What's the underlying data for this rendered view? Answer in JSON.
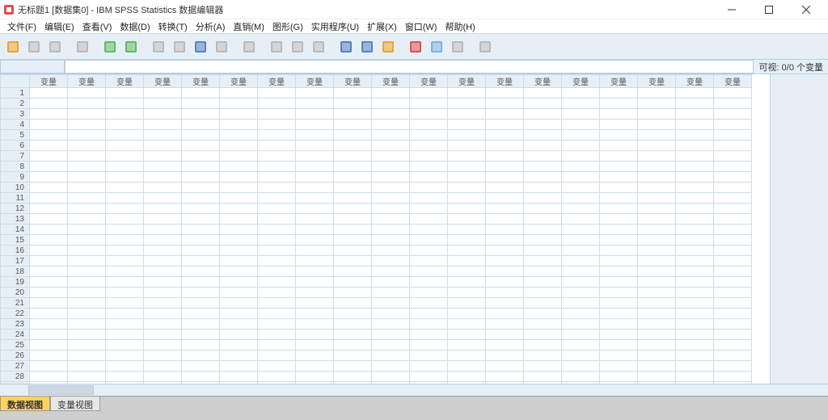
{
  "window": {
    "title": "无标题1 [数据集0] - IBM SPSS Statistics 数据编辑器",
    "visibility_status": "可视: 0/0 个变量"
  },
  "menu": [
    {
      "label": "文件(F)",
      "n": "file"
    },
    {
      "label": "编辑(E)",
      "n": "edit"
    },
    {
      "label": "查看(V)",
      "n": "view"
    },
    {
      "label": "数据(D)",
      "n": "data"
    },
    {
      "label": "转换(T)",
      "n": "transform"
    },
    {
      "label": "分析(A)",
      "n": "analyze"
    },
    {
      "label": "直销(M)",
      "n": "direct"
    },
    {
      "label": "图形(G)",
      "n": "graphs"
    },
    {
      "label": "实用程序(U)",
      "n": "utilities"
    },
    {
      "label": "扩展(X)",
      "n": "extensions"
    },
    {
      "label": "窗口(W)",
      "n": "window"
    },
    {
      "label": "帮助(H)",
      "n": "help"
    }
  ],
  "toolbar": [
    {
      "n": "open-icon",
      "c": "#e6951a",
      "en": true
    },
    {
      "n": "save-icon",
      "c": "#888",
      "en": false
    },
    {
      "n": "print-icon",
      "c": "#888",
      "en": false
    },
    {
      "sep": true
    },
    {
      "n": "recall-icon",
      "c": "#888",
      "en": false
    },
    {
      "sep": true
    },
    {
      "n": "undo-icon",
      "c": "#4caf50",
      "en": true
    },
    {
      "n": "redo-icon",
      "c": "#4caf50",
      "en": true
    },
    {
      "sep": true
    },
    {
      "n": "goto-case-icon",
      "c": "#888",
      "en": false
    },
    {
      "n": "goto-var-icon",
      "c": "#888",
      "en": false
    },
    {
      "n": "vars-icon",
      "c": "#3f6fb5",
      "en": true
    },
    {
      "n": "run-desc-icon",
      "c": "#888",
      "en": false
    },
    {
      "sep": true
    },
    {
      "n": "find-icon",
      "c": "#888",
      "en": false
    },
    {
      "sep": true
    },
    {
      "n": "split-icon",
      "c": "#888",
      "en": false
    },
    {
      "n": "weight-icon",
      "c": "#888",
      "en": false
    },
    {
      "n": "select-cases-icon",
      "c": "#888",
      "en": false
    },
    {
      "sep": true
    },
    {
      "n": "value-labels-icon",
      "c": "#3f6fb5",
      "en": true
    },
    {
      "n": "use-sets-icon",
      "c": "#3f6fb5",
      "en": true
    },
    {
      "n": "show-all-icon",
      "c": "#e6951a",
      "en": true
    },
    {
      "sep": true
    },
    {
      "n": "spellcheck-a-icon",
      "c": "#d13a3a",
      "en": true
    },
    {
      "n": "customize-icon",
      "c": "#6aa7d8",
      "en": true
    },
    {
      "n": "script-icon",
      "c": "#888",
      "en": false
    },
    {
      "sep": true
    },
    {
      "n": "abc-icon",
      "c": "#888",
      "en": false
    }
  ],
  "grid": {
    "col_header": "变量",
    "cols": 19,
    "rows": 30
  },
  "tabs": {
    "data_view": "数据视图",
    "variable_view": "变量视图",
    "active": "data_view"
  }
}
